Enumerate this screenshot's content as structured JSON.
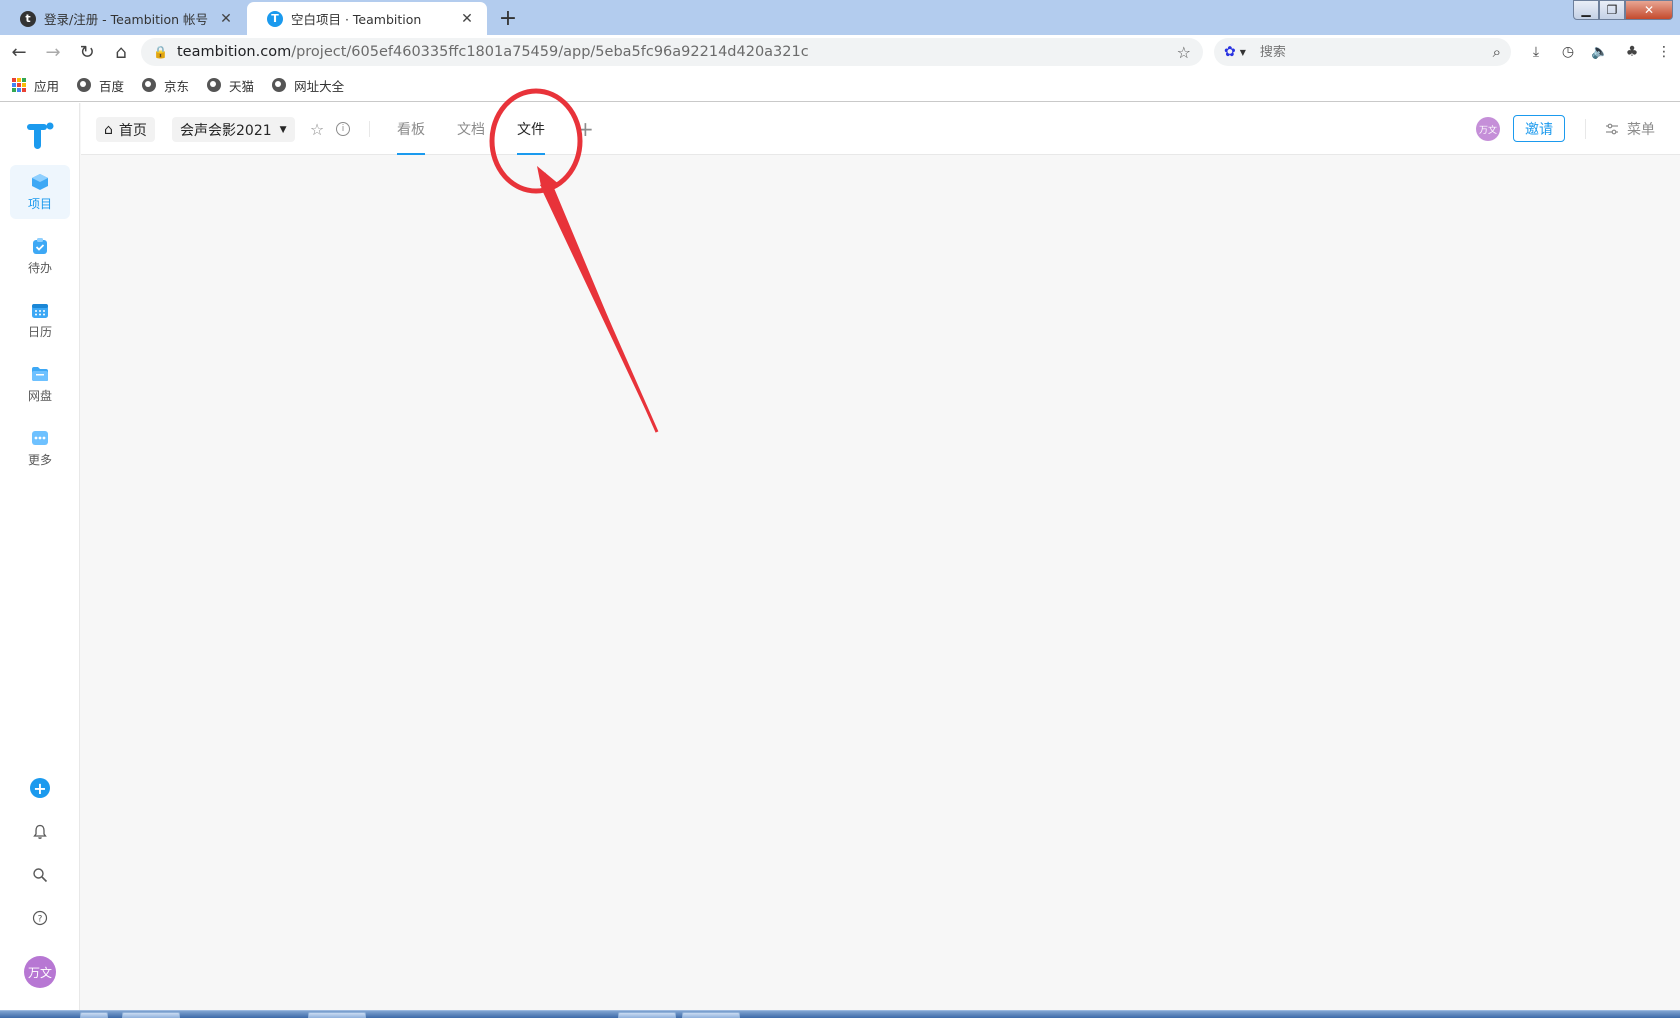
{
  "browser": {
    "tabs": [
      {
        "title": "登录/注册 - Teambition 帐号",
        "favicon": "t",
        "active": false
      },
      {
        "title": "空白项目 · Teambition",
        "favicon": "T",
        "active": true
      }
    ],
    "new_tab_label": "+",
    "url_host": "teambition.com",
    "url_path": "/project/605ef460335ffc1801a75459/app/5eba5fc96a92214d420a321c",
    "search_placeholder": "搜索",
    "bookmarks": [
      {
        "label": "应用",
        "icon": "apps-grid-icon"
      },
      {
        "label": "百度",
        "icon": "globe-icon"
      },
      {
        "label": "京东",
        "icon": "globe-icon"
      },
      {
        "label": "天猫",
        "icon": "globe-icon"
      },
      {
        "label": "网址大全",
        "icon": "globe-icon"
      }
    ]
  },
  "app": {
    "sidebar": {
      "items": [
        {
          "label": "项目",
          "icon": "project-cube-icon",
          "color": "#1b9aee",
          "active": true
        },
        {
          "label": "待办",
          "icon": "todo-clipboard-icon",
          "color": "#3da8f5",
          "active": false
        },
        {
          "label": "日历",
          "icon": "calendar-icon",
          "color": "#3da8f5",
          "active": false
        },
        {
          "label": "网盘",
          "icon": "folder-icon",
          "color": "#3da8f5",
          "active": false
        },
        {
          "label": "更多",
          "icon": "more-dots-icon",
          "color": "#3da8f5",
          "active": false
        }
      ],
      "user_initials": "万文"
    },
    "header": {
      "home_label": "首页",
      "project_name": "会声会影2021",
      "tabs": [
        {
          "label": "看板",
          "active": false,
          "underlined": true
        },
        {
          "label": "文档",
          "active": false,
          "underlined": false
        },
        {
          "label": "文件",
          "active": true,
          "underlined": true
        }
      ],
      "member_initials": "万文",
      "invite_label": "邀请",
      "menu_label": "菜单"
    },
    "accent_color": "#1b9aee"
  },
  "annotation": {
    "color": "#e8333a",
    "target": "文件"
  }
}
